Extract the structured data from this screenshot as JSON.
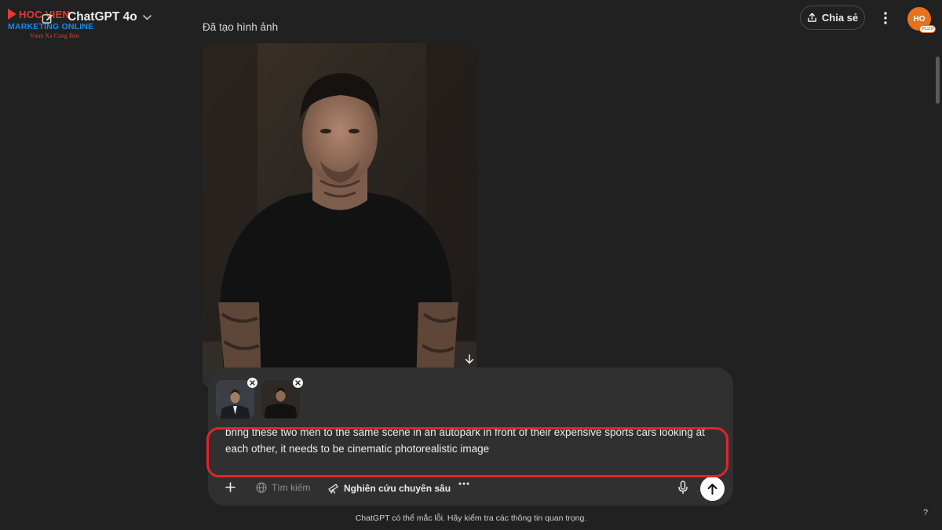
{
  "logo": {
    "name": "HOC VIEN",
    "marketing": "MARKETING ONLINE",
    "slogan": "Vuon Xa Cung Ban"
  },
  "header": {
    "model_name": "ChatGPT 4o",
    "share_label": "Chia sẻ",
    "avatar_initials": "HO",
    "avatar_badge": "PLUS"
  },
  "chat": {
    "status_label": "Đã tạo hình ảnh"
  },
  "composer": {
    "prompt_text": "bring these two men to the same scene in an autopark in front of their expensive sports cars looking at each other, it needs to be cinematic photorealistic image",
    "tools": {
      "search": "Tìm kiếm",
      "deep_research": "Nghiên cứu chuyên sâu"
    }
  },
  "footer": {
    "disclaimer": "ChatGPT có thể mắc lỗi. Hãy kiểm tra các thông tin quan trọng.",
    "help": "?"
  },
  "colors": {
    "background": "#212121",
    "composer": "#303030",
    "highlight": "#e3232b",
    "avatar": "#e8711a"
  },
  "icons": [
    "edit-icon",
    "chevron-down-icon",
    "share-icon",
    "more-vertical-icon",
    "download-icon",
    "close-icon",
    "plus-icon",
    "globe-icon",
    "telescope-icon",
    "more-horizontal-icon",
    "microphone-icon",
    "arrow-up-icon"
  ]
}
